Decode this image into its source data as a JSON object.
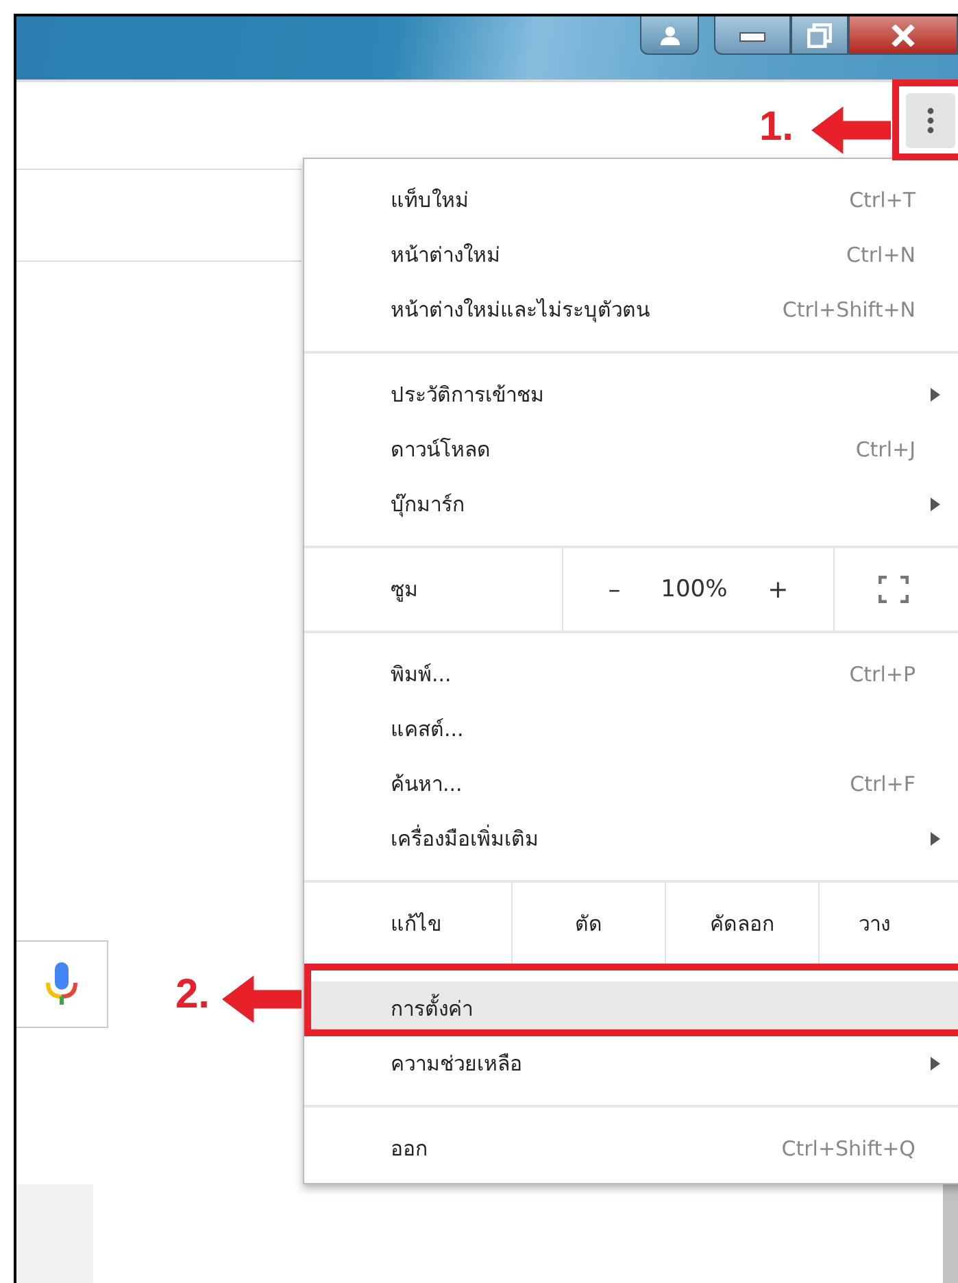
{
  "menu": {
    "sections": [
      {
        "kind": "items",
        "items": [
          {
            "label": "แท็บใหม่",
            "shortcut": "Ctrl+T",
            "submenu": false,
            "selected": false
          },
          {
            "label": "หน้าต่างใหม่",
            "shortcut": "Ctrl+N",
            "submenu": false,
            "selected": false
          },
          {
            "label": "หน้าต่างใหม่และไม่ระบุตัวตน",
            "shortcut": "Ctrl+Shift+N",
            "submenu": false,
            "selected": false
          }
        ]
      },
      {
        "kind": "items",
        "items": [
          {
            "label": "ประวัติการเข้าชม",
            "submenu": true,
            "selected": false
          },
          {
            "label": "ดาวน์โหลด",
            "shortcut": "Ctrl+J",
            "submenu": false,
            "selected": false
          },
          {
            "label": "บุ๊กมาร์ก",
            "submenu": true,
            "selected": false
          }
        ]
      },
      {
        "kind": "zoom",
        "label": "ซูม",
        "minus": "–",
        "value": "100%",
        "plus": "+"
      },
      {
        "kind": "items",
        "items": [
          {
            "label": "พิมพ์...",
            "shortcut": "Ctrl+P",
            "submenu": false,
            "selected": false
          },
          {
            "label": "แคสต์...",
            "submenu": false,
            "selected": false
          },
          {
            "label": "ค้นหา...",
            "shortcut": "Ctrl+F",
            "submenu": false,
            "selected": false
          },
          {
            "label": "เครื่องมือเพิ่มเติม",
            "submenu": true,
            "selected": false
          }
        ]
      },
      {
        "kind": "edit",
        "label": "แก้ไข",
        "cut": "ตัด",
        "copy": "คัดลอก",
        "paste": "วาง"
      },
      {
        "kind": "items",
        "items": [
          {
            "label": "การตั้งค่า",
            "submenu": false,
            "selected": true
          },
          {
            "label": "ความช่วยเหลือ",
            "submenu": true,
            "selected": false
          }
        ]
      },
      {
        "kind": "items",
        "items": [
          {
            "label": "ออก",
            "shortcut": "Ctrl+Shift+Q",
            "submenu": false,
            "selected": false
          }
        ]
      }
    ]
  },
  "annotations": [
    {
      "label": "1."
    },
    {
      "label": "2."
    }
  ]
}
